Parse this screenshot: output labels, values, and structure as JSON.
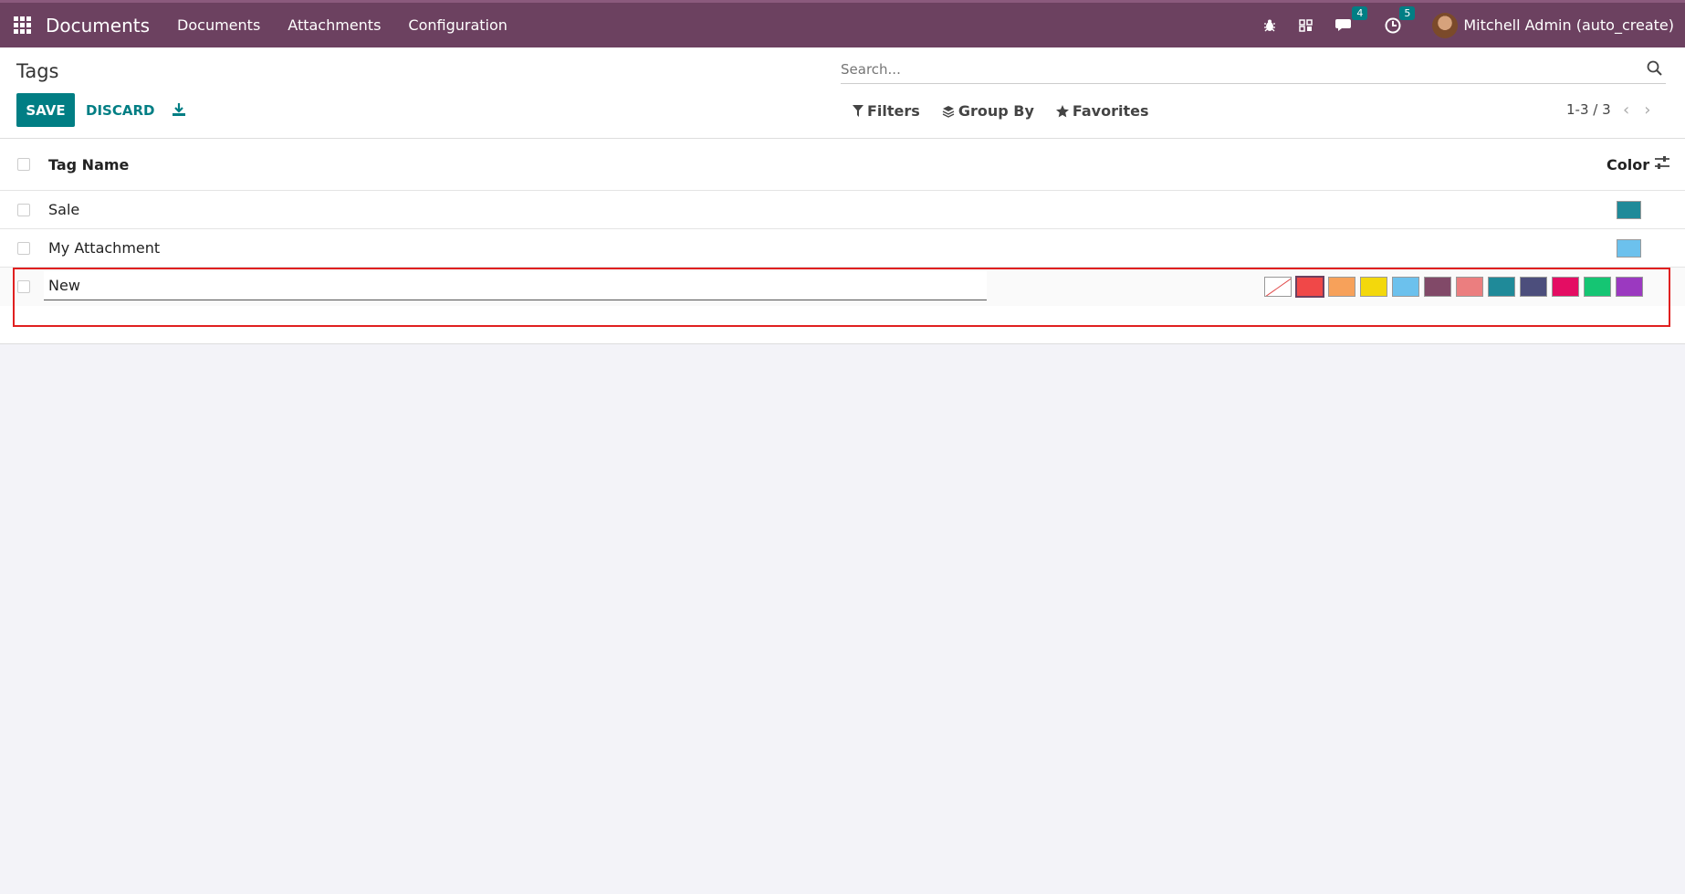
{
  "navbar": {
    "brand": "Documents",
    "menu": [
      "Documents",
      "Attachments",
      "Configuration"
    ],
    "messages_count": "4",
    "activities_count": "5",
    "user": "Mitchell Admin (auto_create)"
  },
  "control": {
    "title": "Tags",
    "save_label": "SAVE",
    "discard_label": "DISCARD",
    "search_placeholder": "Search...",
    "filters_label": "Filters",
    "groupby_label": "Group By",
    "favorites_label": "Favorites",
    "pager": "1-3 / 3"
  },
  "table": {
    "headers": {
      "name": "Tag Name",
      "color": "Color"
    },
    "rows": [
      {
        "name": "Sale",
        "color": "#1f8a99"
      },
      {
        "name": "My Attachment",
        "color": "#6cc1ed"
      }
    ],
    "edit_row": {
      "value": "New"
    },
    "palette": [
      "#ffffff",
      "#f04848",
      "#f7a15a",
      "#f3d80c",
      "#6cc1ed",
      "#814968",
      "#eb7e7f",
      "#1f8a99",
      "#4c4e7c",
      "#e40d63",
      "#15c573",
      "#9b39c0"
    ]
  }
}
